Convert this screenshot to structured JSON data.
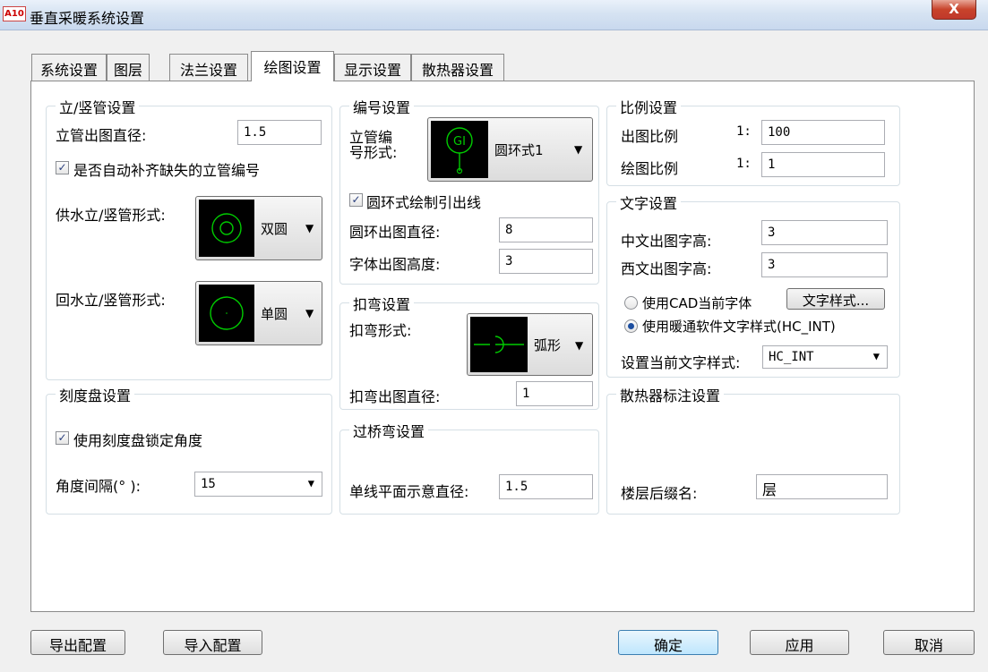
{
  "window": {
    "icon_text": "A10",
    "title": "垂直采暖系统设置",
    "close_label": "X"
  },
  "tabs": [
    {
      "label": "系统设置",
      "active": false
    },
    {
      "label": "图层",
      "active": false
    },
    {
      "label": "法兰设置",
      "active": false
    },
    {
      "label": "绘图设置",
      "active": true
    },
    {
      "label": "显示设置",
      "active": false
    },
    {
      "label": "散热器设置",
      "active": false
    }
  ],
  "riser": {
    "title": "立/竖管设置",
    "diameter_label": "立管出图直径:",
    "diameter_value": "1.5",
    "auto_fill_label": "是否自动补齐缺失的立管编号",
    "auto_fill_checked": true,
    "supply_label": "供水立/竖管形式:",
    "supply_value": "双圆",
    "return_label": "回水立/竖管形式:",
    "return_value": "单圆"
  },
  "dial": {
    "title": "刻度盘设置",
    "lock_label": "使用刻度盘锁定角度",
    "lock_checked": true,
    "interval_label": "角度间隔(° ):",
    "interval_value": "15"
  },
  "numbering": {
    "title": "编号设置",
    "form_label_1": "立管编",
    "form_label_2": "号形式:",
    "form_value": "圆环式1",
    "preview_text": "GI",
    "leader_label": "圆环式绘制引出线",
    "leader_checked": true,
    "ring_diameter_label": "圆环出图直径:",
    "ring_diameter_value": "8",
    "font_height_label": "字体出图高度:",
    "font_height_value": "3"
  },
  "bend": {
    "title": "扣弯设置",
    "form_label": "扣弯形式:",
    "form_value": "弧形",
    "diameter_label": "扣弯出图直径:",
    "diameter_value": "1"
  },
  "bridge": {
    "title": "过桥弯设置",
    "diameter_label": "单线平面示意直径:",
    "diameter_value": "1.5"
  },
  "scale": {
    "title": "比例设置",
    "output_label": "出图比例",
    "output_prefix": "1:",
    "output_value": "100",
    "drawing_label": "绘图比例",
    "drawing_prefix": "1:",
    "drawing_value": "1"
  },
  "text": {
    "title": "文字设置",
    "cn_height_label": "中文出图字高:",
    "cn_height_value": "3",
    "en_height_label": "西文出图字高:",
    "en_height_value": "3",
    "use_cad_label": "使用CAD当前字体",
    "use_cad_selected": false,
    "style_button": "文字样式...",
    "use_hvac_label": "使用暖通软件文字样式(HC_INT)",
    "use_hvac_selected": true,
    "current_style_label": "设置当前文字样式:",
    "current_style_value": "HC_INT"
  },
  "radiator": {
    "title": "散热器标注设置",
    "suffix_label": "楼层后缀名:",
    "suffix_value": "层"
  },
  "footer": {
    "export_label": "导出配置",
    "import_label": "导入配置",
    "ok_label": "确定",
    "apply_label": "应用",
    "cancel_label": "取消"
  },
  "colors": {
    "preview_bg": "#000000",
    "preview_line": "#00cc00",
    "primary_button": "#bee6fd"
  }
}
